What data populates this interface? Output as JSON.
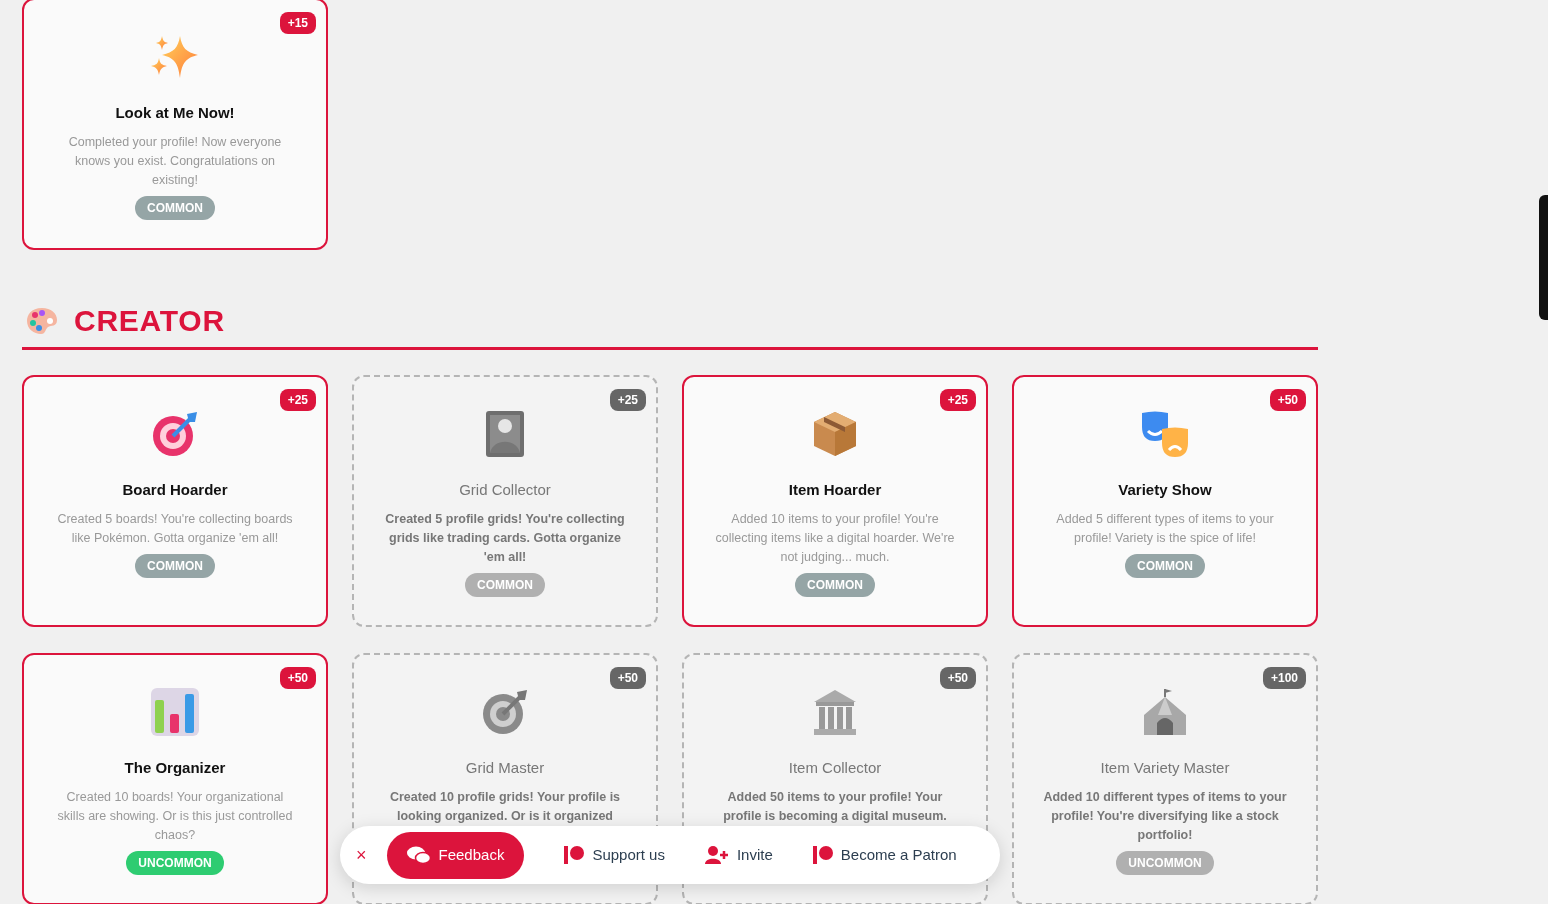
{
  "top_cards": [
    {
      "title": "Look at Me Now!",
      "description": "Completed your profile! Now everyone knows you exist. Congratulations on existing!",
      "rarity": "COMMON",
      "color": "#95a5a6",
      "points": "+15",
      "unlocked": true
    }
  ],
  "section": {
    "title": "CREATOR",
    "cards": [
      {
        "title": "Board Hoarder",
        "description": "Created 5 boards! You're collecting boards like Pokémon. Gotta organize 'em all!",
        "rarity": "COMMON",
        "color": "#95a5a6",
        "points": "+25",
        "unlocked": true
      },
      {
        "title": "Grid Collector",
        "description": "Created 5 profile grids! You're collecting grids like trading cards. Gotta organize 'em all!",
        "rarity": "COMMON",
        "color": "#b0b0b0",
        "points": "+25",
        "unlocked": false
      },
      {
        "title": "Item Hoarder",
        "description": "Added 10 items to your profile! You're collecting items like a digital hoarder. We're not judging... much.",
        "rarity": "COMMON",
        "color": "#95a5a6",
        "points": "+25",
        "unlocked": true
      },
      {
        "title": "Variety Show",
        "description": "Added 5 different types of items to your profile! Variety is the spice of life!",
        "rarity": "COMMON",
        "color": "#95a5a6",
        "points": "+50",
        "unlocked": true
      },
      {
        "title": "The Organizer",
        "description": "Created 10 boards! Your organizational skills are showing. Or is this just controlled chaos?",
        "rarity": "UNCOMMON",
        "color": "#2ecc71",
        "points": "+50",
        "unlocked": true
      },
      {
        "title": "Grid Master",
        "description": "Created 10 profile grids! Your profile is looking organized. Or is it organized",
        "points": "+50",
        "unlocked": false
      },
      {
        "title": "Item Collector",
        "description": "Added 50 items to your profile! Your profile is becoming a digital museum.",
        "points": "+50",
        "unlocked": false
      },
      {
        "title": "Item Variety Master",
        "description": "Added 10 different types of items to your profile! You're diversifying like a stock portfolio!",
        "rarity": "UNCOMMON",
        "color": "#b0b0b0",
        "points": "+100",
        "unlocked": false
      }
    ]
  },
  "bottom_bar": {
    "close": "×",
    "feedback": "Feedback",
    "links": [
      {
        "kind": "patreon",
        "label": "Support us"
      },
      {
        "kind": "invite",
        "label": "Invite"
      },
      {
        "kind": "patreon",
        "label": "Become a Patron"
      }
    ]
  }
}
